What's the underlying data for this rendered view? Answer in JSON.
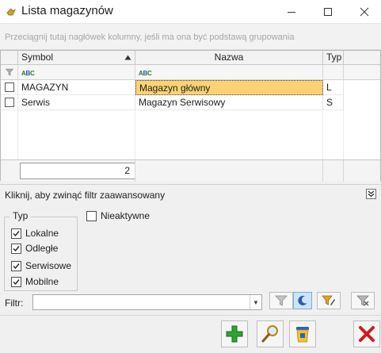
{
  "window": {
    "title": "Lista magazynów"
  },
  "group_hint": "Przeciągnij tutaj nagłówek kolumny, jeśli ma ona być podstawą grupowania",
  "columns": {
    "symbol": "Symbol",
    "nazwa": "Nazwa",
    "typ": "Typ"
  },
  "rows": [
    {
      "symbol": "MAGAZYN",
      "nazwa": "Magazyn główny",
      "typ": "L",
      "selected": true
    },
    {
      "symbol": "Serwis",
      "nazwa": "Magazyn Serwisowy",
      "typ": "S",
      "selected": false
    }
  ],
  "row_count": "2",
  "advanced": {
    "toggle_text": "Kliknij, aby zwinąć filtr zaawansowany"
  },
  "typ_group": {
    "legend": "Typ",
    "options": [
      {
        "label": "Lokalne",
        "checked": true
      },
      {
        "label": "Odległe",
        "checked": true
      },
      {
        "label": "Serwisowe",
        "checked": true
      },
      {
        "label": "Mobilne",
        "checked": true
      }
    ]
  },
  "nieaktywne": {
    "label": "Nieaktywne",
    "checked": false
  },
  "filter": {
    "label": "Filtr:",
    "value": ""
  },
  "colors": {
    "selected_cell": "#fcd374",
    "add_green": "#2fa32f",
    "delete_red": "#d11a1a"
  }
}
